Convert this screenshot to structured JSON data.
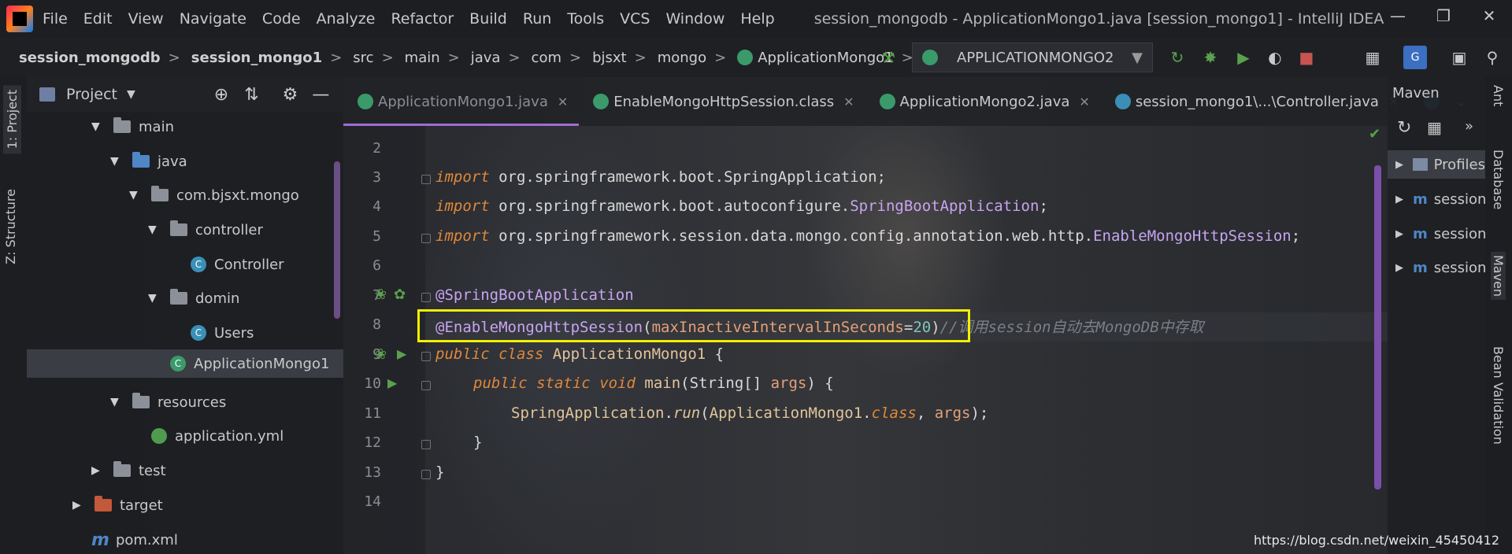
{
  "menu": {
    "items": [
      "File",
      "Edit",
      "View",
      "Navigate",
      "Code",
      "Analyze",
      "Refactor",
      "Build",
      "Run",
      "Tools",
      "VCS",
      "Window",
      "Help"
    ],
    "window_title": "session_mongodb - ApplicationMongo1.java [session_mongo1] - IntelliJ IDEA"
  },
  "breadcrumb": [
    "session_mongodb",
    "session_mongo1",
    "src",
    "main",
    "java",
    "com",
    "bjsxt",
    "mongo",
    "ApplicationMongo1"
  ],
  "run_config": "APPLICATIONMONGO2",
  "left_stripe": {
    "project": "1: Project",
    "structure": "Z: Structure"
  },
  "project_panel": {
    "title": "Project",
    "tree": [
      "main",
      "java",
      "com.bjsxt.mongo",
      "controller",
      "Controller",
      "domin",
      "Users",
      "ApplicationMongo1",
      "resources",
      "application.yml",
      "test",
      "target",
      "pom.xml"
    ]
  },
  "tabs": [
    "ApplicationMongo1.java",
    "EnableMongoHttpSession.class",
    "ApplicationMongo2.java",
    "session_mongo1\\...\\Controller.java"
  ],
  "editor": {
    "line_numbers": [
      "2",
      "3",
      "4",
      "5",
      "6",
      "7",
      "8",
      "9",
      "10",
      "11",
      "12",
      "13",
      "14"
    ],
    "import1_kw": "import",
    "import1": "org.springframework.boot.SpringApplication;",
    "import2_pkg": "org.springframework.boot.autoconfigure.",
    "import2_cls": "SpringBootApplication",
    "import3_pkg": "org.springframework.session.data.mongo.config.annotation.web.http.",
    "import3_cls": "EnableMongoHttpSession",
    "semicolon": ";",
    "ann1": "@SpringBootApplication",
    "ann2": "@EnableMongoHttpSession",
    "param": "maxInactiveIntervalInSeconds",
    "value": "20",
    "comment": "//调用session自动去MongoDB中存取",
    "kw_public": "public",
    "kw_class": "class",
    "class_name": "ApplicationMongo1",
    "brace_open": "{",
    "kw_static": "static",
    "kw_void": "void",
    "method": "main",
    "params_type": "String[]",
    "params_name": "args",
    "call_cls": "SpringApplication",
    "call_method": "run",
    "call_arg_cls": "ApplicationMongo1",
    "call_class_kw": "class",
    "brace_close": "}"
  },
  "maven": {
    "title": "Maven",
    "items": [
      "Profiles",
      "session_",
      "session_",
      "session_"
    ]
  },
  "right_stripe": [
    "Ant",
    "Database",
    "Maven",
    "Bean Validation"
  ],
  "watermark": "https://blog.csdn.net/weixin_45450412"
}
